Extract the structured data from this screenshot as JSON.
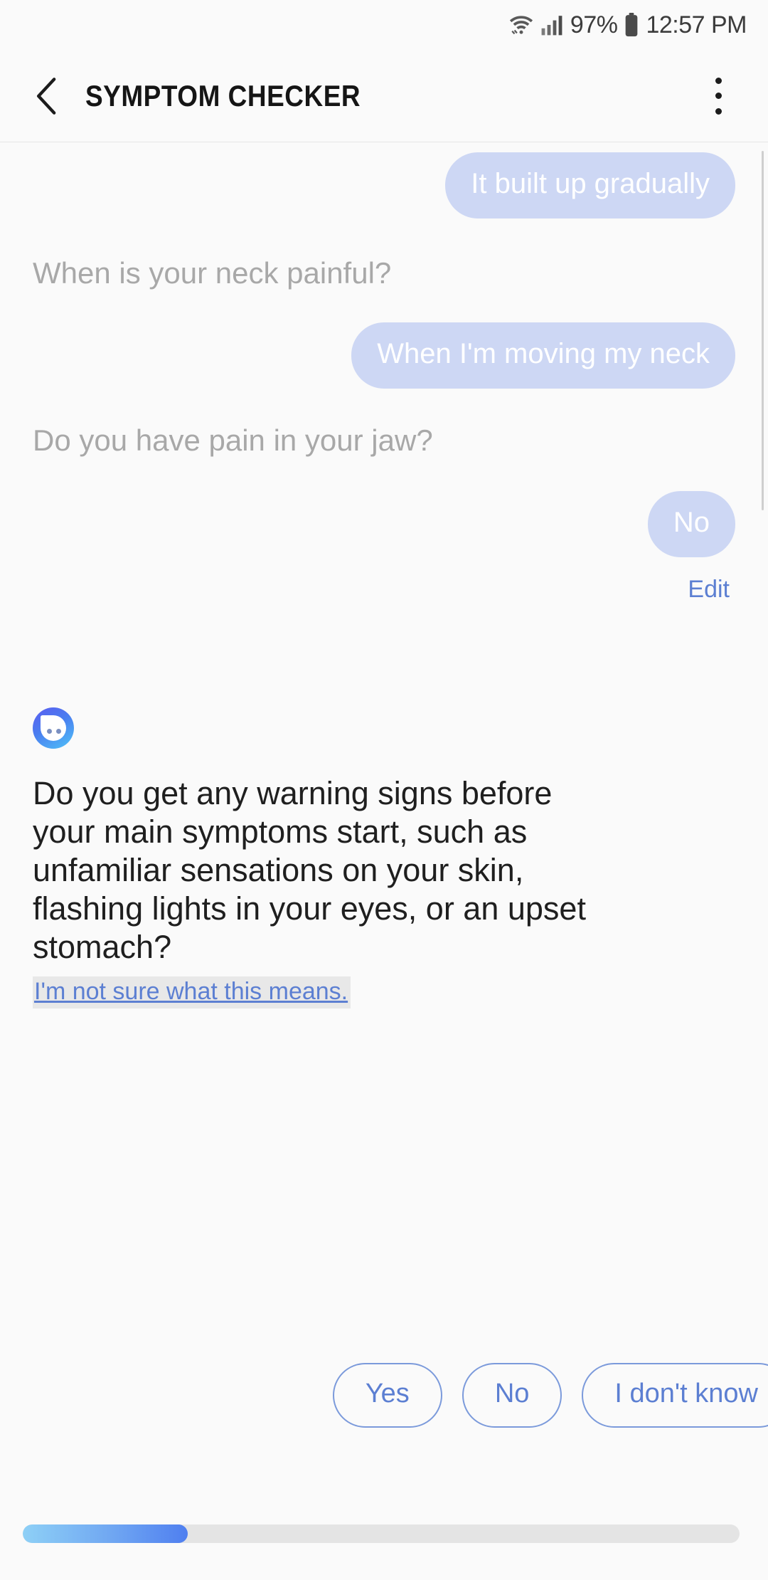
{
  "status_bar": {
    "battery_percent": "97%",
    "time": "12:57 PM",
    "icons": [
      "wifi-icon",
      "cellular-signal-icon",
      "battery-icon"
    ]
  },
  "header": {
    "title": "SYMPTOM CHECKER",
    "back_icon": "chevron-left-icon",
    "overflow_icon": "more-vertical-icon"
  },
  "conversation": [
    {
      "role": "user",
      "text": "It built up gradually"
    },
    {
      "role": "bot",
      "text": "When is your neck painful?"
    },
    {
      "role": "user",
      "text": "When I'm moving my neck"
    },
    {
      "role": "bot",
      "text": "Do you have pain in your jaw?"
    },
    {
      "role": "user",
      "text": "No"
    }
  ],
  "edit_label": "Edit",
  "current_question": {
    "avatar_icon": "chatbot-avatar-icon",
    "text": "Do you get any warning signs before your main symptoms start, such as unfamiliar sensations on your skin, flashing lights in your eyes, or an upset stomach?",
    "help_link": "I'm not sure what this means."
  },
  "answers": [
    {
      "label": "Yes"
    },
    {
      "label": "No"
    },
    {
      "label": "I don't know"
    }
  ],
  "progress": {
    "percent": 23
  },
  "colors": {
    "user_bubble": "#cdd7f4",
    "accent_blue": "#5c7fd2",
    "faded_text": "#a8a8a8",
    "background": "#fafafa"
  }
}
